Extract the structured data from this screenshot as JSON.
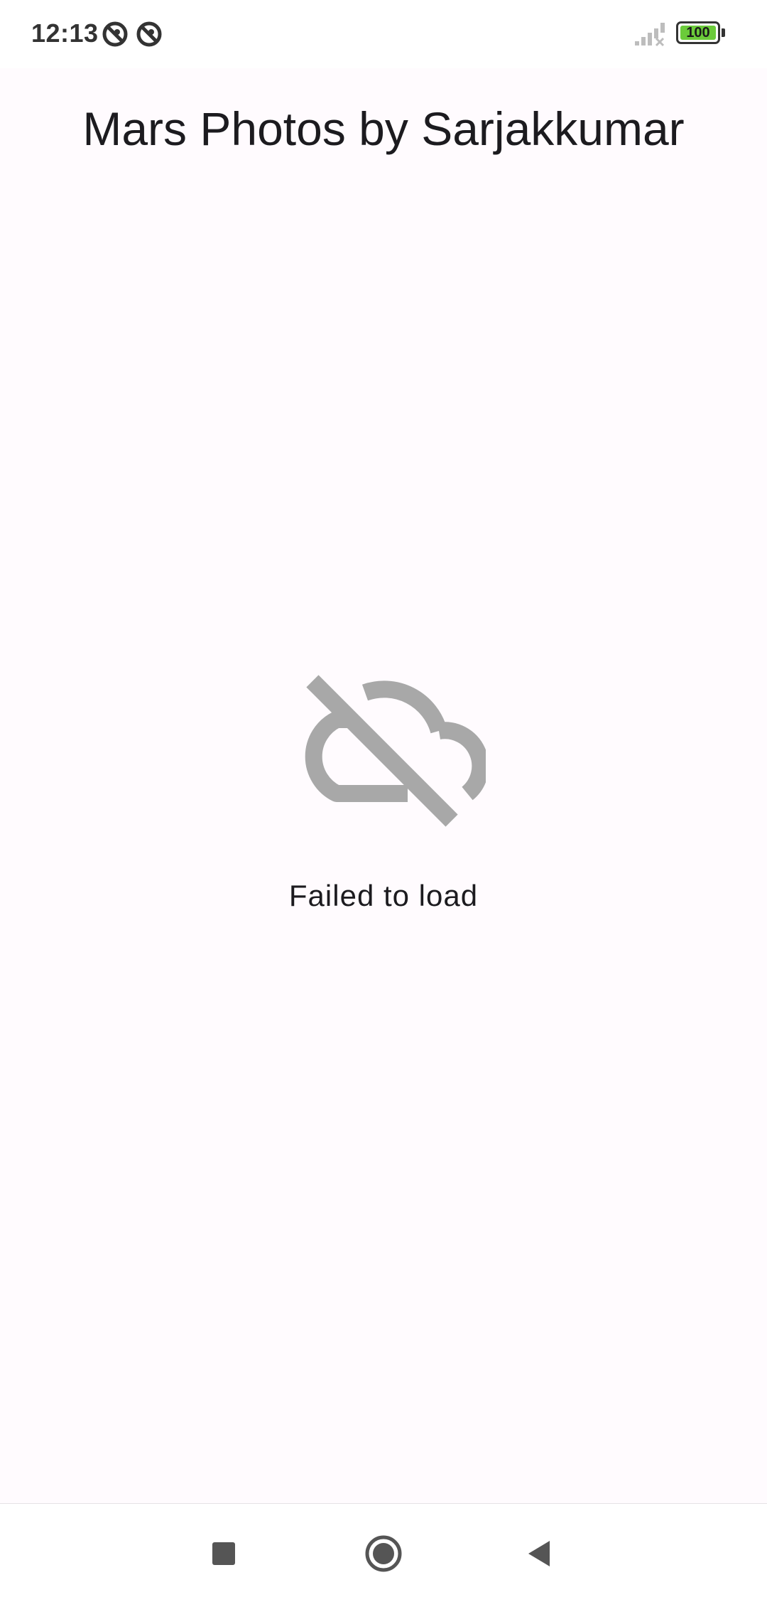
{
  "status_bar": {
    "time": "12:13",
    "notification_icons": [
      "do-not-disturb-icon",
      "do-not-disturb-icon"
    ],
    "signal_icon": "signal-no-service-icon",
    "battery_level": "100",
    "battery_color": "#6BCB3A"
  },
  "app_bar": {
    "title": "Mars Photos by Sarjakkumar"
  },
  "error_state": {
    "icon": "cloud-off-icon",
    "message": "Failed to load",
    "icon_color": "#A8A8A8"
  },
  "nav_bar": {
    "buttons": [
      "recents-button",
      "home-button",
      "back-button"
    ]
  }
}
